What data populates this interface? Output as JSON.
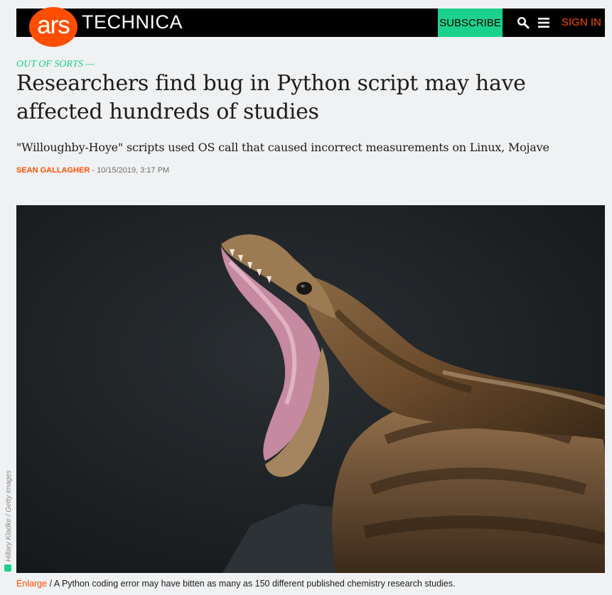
{
  "header": {
    "logo_ars": "ars",
    "logo_technica": "TECHNICA",
    "subscribe_label": "SUBSCRIBE",
    "search_icon": "search-icon",
    "menu_icon": "hamburger-menu-icon",
    "signin_label": "SIGN IN"
  },
  "article": {
    "kicker": "OUT OF SORTS —",
    "title": "Researchers find bug in Python script may have affected hundreds of studies",
    "dek": "\"Willoughby-Hoye\" scripts used OS call that caused incorrect measurements on Linux, Mojave",
    "author": "SEAN GALLAGHER",
    "separator": " - ",
    "date": "10/15/2019, 3:17 PM"
  },
  "image": {
    "credit": "Hillary Kladke / Getty Images",
    "enlarge_label": "Enlarge",
    "caption": " / A Python coding error may have bitten as many as 150 different published chemistry research studies."
  },
  "colors": {
    "brand": "#ff4e00",
    "accent": "#1bd18c",
    "nav_bg": "#000000",
    "page_bg": "#f0f1f2"
  }
}
